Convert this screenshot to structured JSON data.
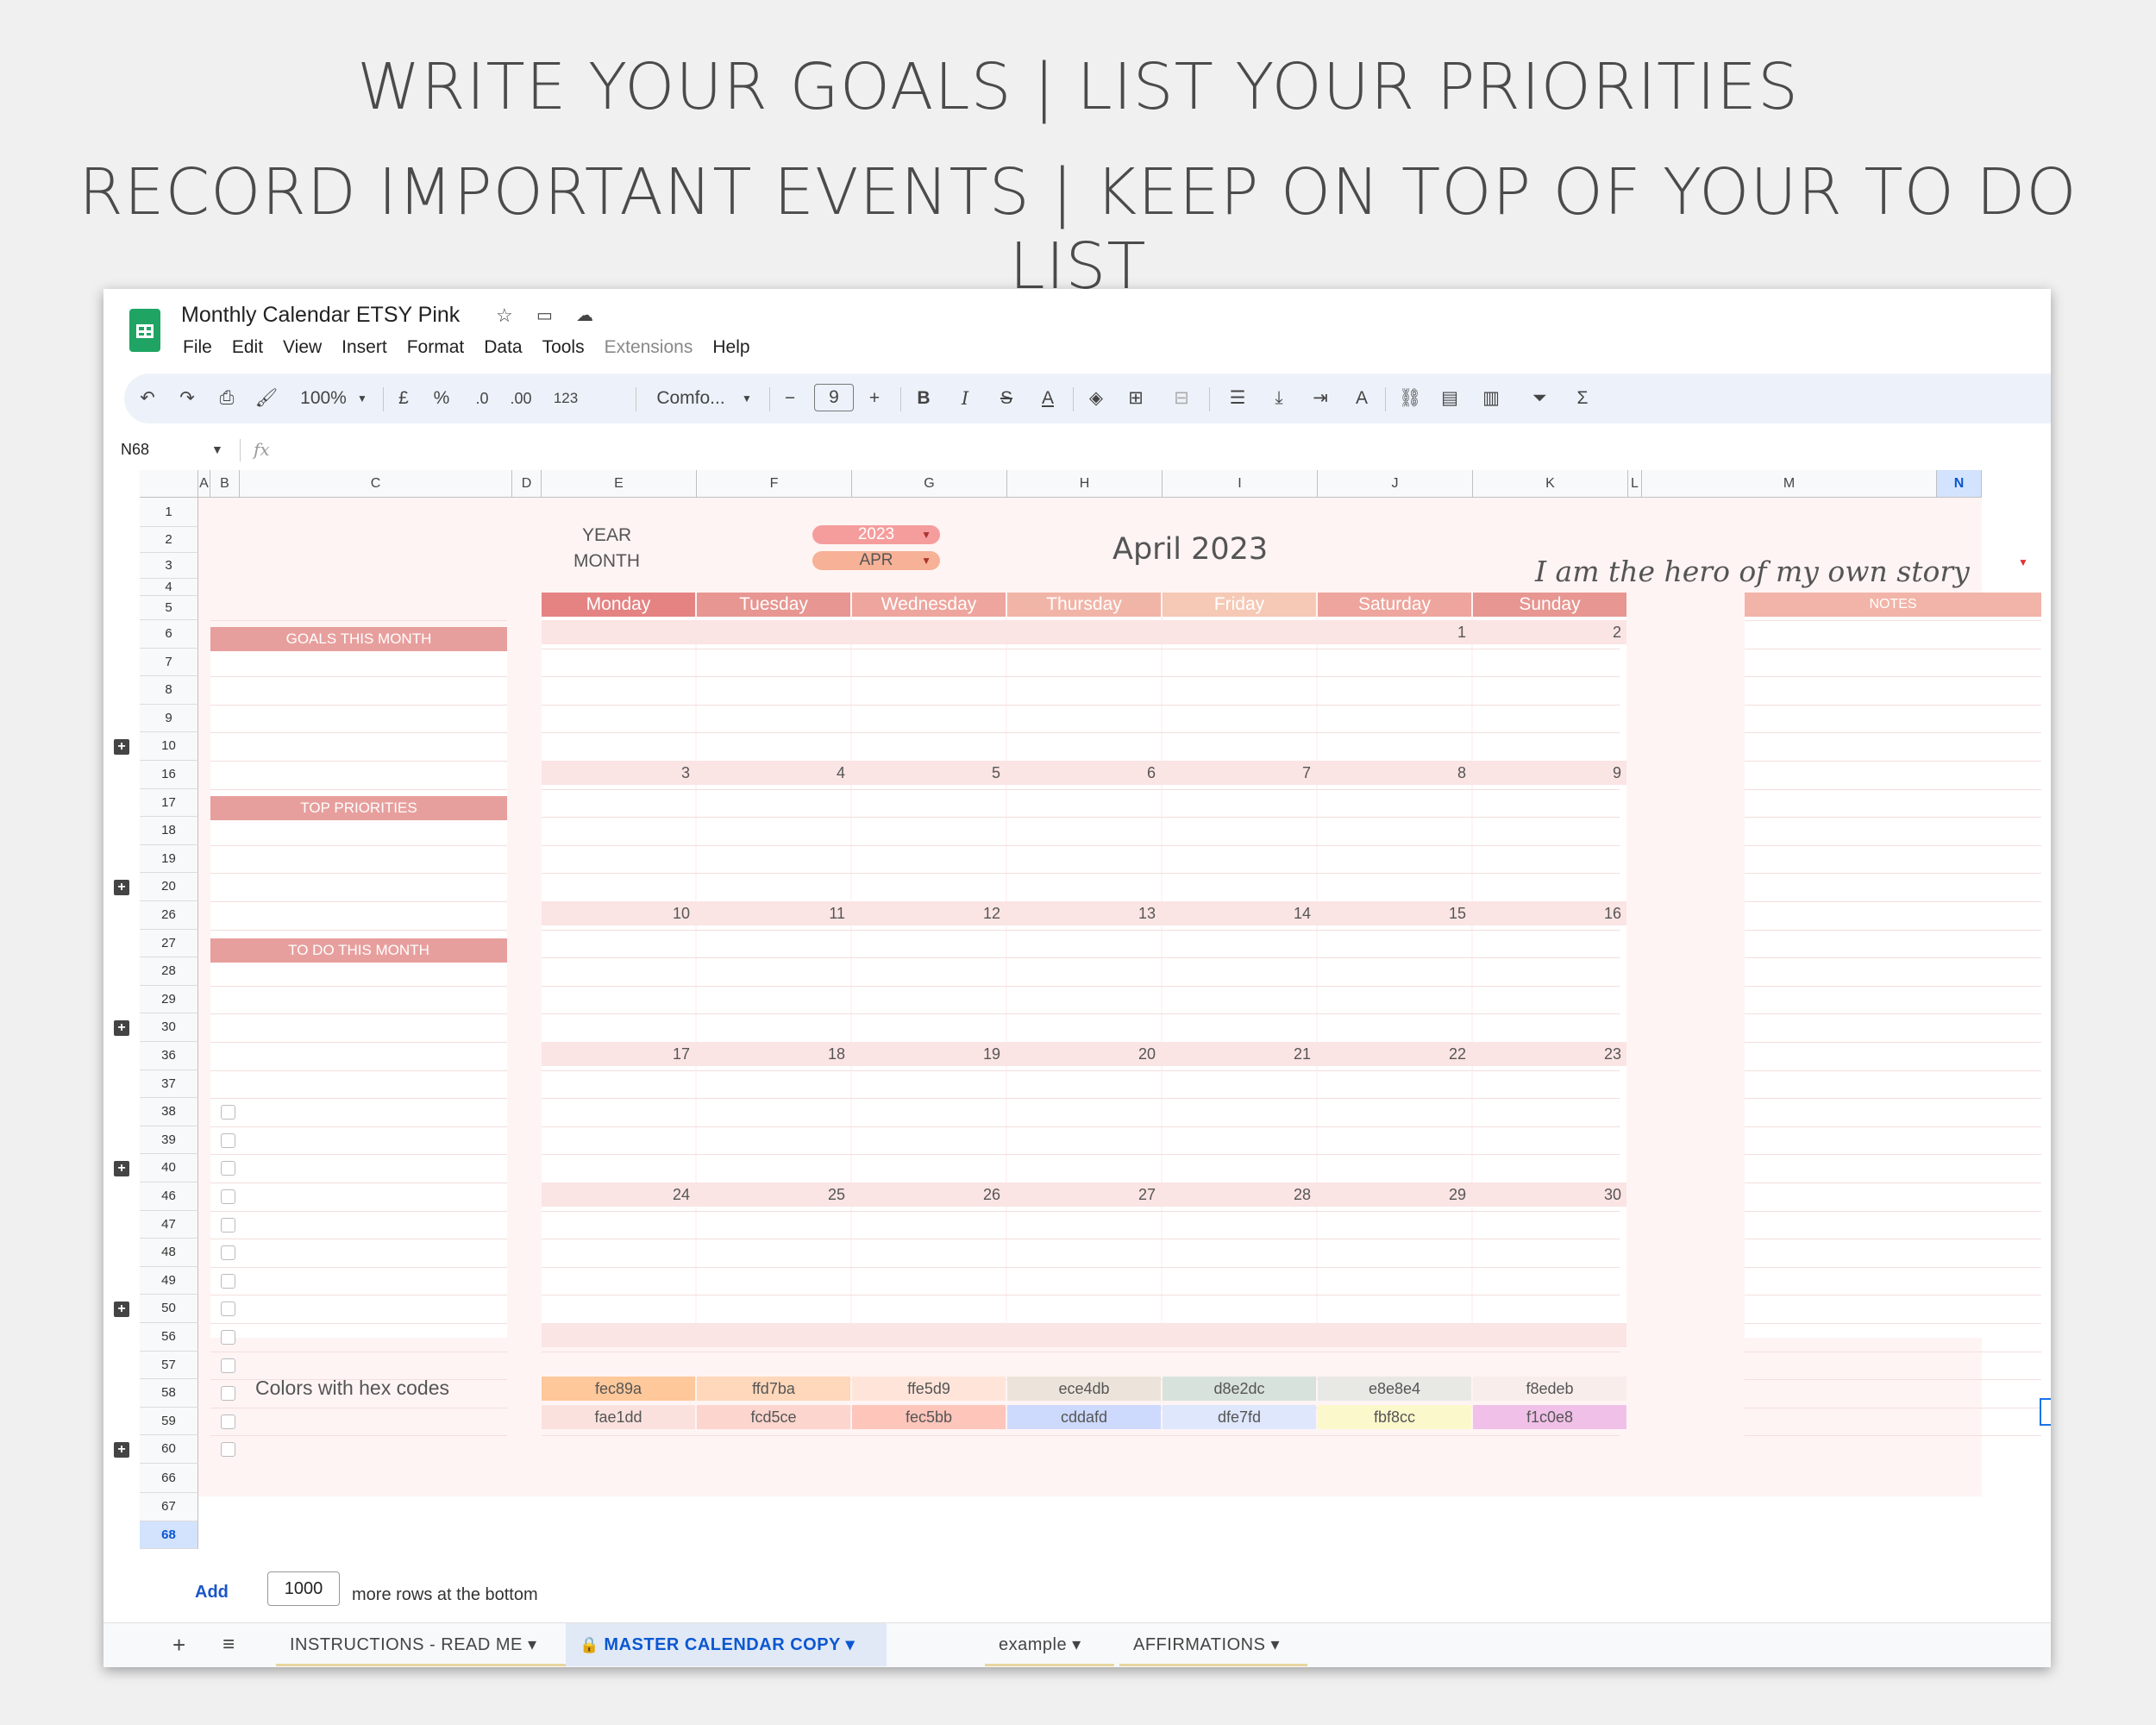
{
  "banner": {
    "line1": "WRITE YOUR GOALS | LIST YOUR PRIORITIES",
    "line2": "RECORD IMPORTANT EVENTS | KEEP ON TOP OF YOUR TO DO LIST"
  },
  "app": {
    "title": "Monthly Calendar ETSY Pink",
    "menu": [
      "File",
      "Edit",
      "View",
      "Insert",
      "Format",
      "Data",
      "Tools",
      "Extensions",
      "Help"
    ]
  },
  "toolbar": {
    "zoom": "100%",
    "currency": "£",
    "percent": "%",
    "dec_decrease": ".0",
    "dec_increase": ".00",
    "number_format": "123",
    "font": "Comfo...",
    "font_size": "9",
    "bold": "B",
    "italic": "I",
    "sum": "Σ"
  },
  "formula_bar": {
    "name_box": "N68",
    "fx": "fx"
  },
  "columns": [
    "A",
    "B",
    "C",
    "D",
    "E",
    "F",
    "G",
    "H",
    "I",
    "J",
    "K",
    "L",
    "M",
    "N"
  ],
  "rows": [
    "1",
    "2",
    "3",
    "4",
    "5",
    "6",
    "7",
    "8",
    "9",
    "10",
    "16",
    "17",
    "18",
    "19",
    "20",
    "26",
    "27",
    "28",
    "29",
    "30",
    "36",
    "37",
    "38",
    "39",
    "40",
    "46",
    "47",
    "48",
    "49",
    "50",
    "56",
    "57",
    "58",
    "59",
    "60",
    "66",
    "67",
    "68"
  ],
  "selected_row": "68",
  "selected_col": "N",
  "calendar": {
    "year_label": "YEAR",
    "year_value": "2023",
    "month_label": "MONTH",
    "month_value": "APR",
    "title": "April 2023",
    "affirmation": "I am the hero of my own story",
    "days": [
      "Monday",
      "Tuesday",
      "Wednesday",
      "Thursday",
      "Friday",
      "Saturday",
      "Sunday"
    ],
    "notes_label": "NOTES",
    "goals_label": "GOALS THIS MONTH",
    "priorities_label": "TOP PRIORITIES",
    "todo_label": "TO DO THIS MONTH",
    "weeks": [
      [
        "",
        "",
        "",
        "",
        "",
        "1",
        "2"
      ],
      [
        "3",
        "4",
        "5",
        "6",
        "7",
        "8",
        "9"
      ],
      [
        "10",
        "11",
        "12",
        "13",
        "14",
        "15",
        "16"
      ],
      [
        "17",
        "18",
        "19",
        "20",
        "21",
        "22",
        "23"
      ],
      [
        "24",
        "25",
        "26",
        "27",
        "28",
        "29",
        "30"
      ],
      [
        "",
        "",
        "",
        "",
        "",
        "",
        ""
      ]
    ],
    "day_header_colors": [
      "#e58383",
      "#e79691",
      "#eea59d",
      "#f1b5a8",
      "#f5c9b5",
      "#eea59d",
      "#e79691"
    ],
    "colors_label": "Colors with hex codes",
    "hex_row1": [
      "fec89a",
      "ffd7ba",
      "ffe5d9",
      "ece4db",
      "d8e2dc",
      "e8e8e4",
      "f8edeb"
    ],
    "hex_row2": [
      "fae1dd",
      "fcd5ce",
      "fec5bb",
      "cddafd",
      "dfe7fd",
      "fbf8cc",
      "f1c0e8"
    ]
  },
  "add_rows": {
    "add": "Add",
    "count": "1000",
    "suffix": "more rows at the bottom"
  },
  "tabs": [
    {
      "label": "INSTRUCTIONS - READ ME",
      "active": false
    },
    {
      "label": "MASTER CALENDAR COPY",
      "active": true
    },
    {
      "label": "example",
      "active": false
    },
    {
      "label": "AFFIRMATIONS",
      "active": false
    }
  ]
}
